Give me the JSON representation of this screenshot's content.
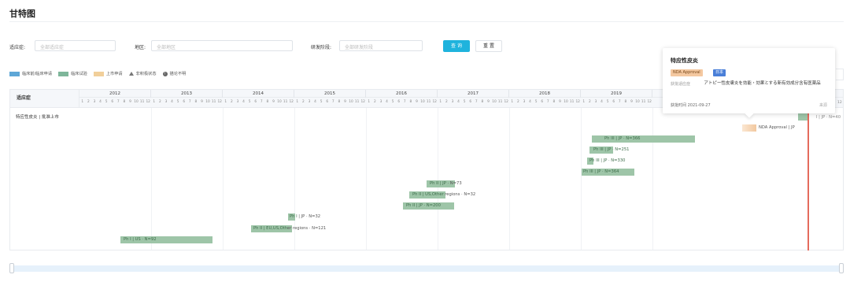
{
  "page": {
    "title": "甘特图"
  },
  "filters": {
    "indication_label": "适应症:",
    "indication_placeholder": "全部适应症",
    "region_label": "地区:",
    "region_placeholder": "全部地区",
    "phase_label": "研发阶段:",
    "phase_placeholder": "全部研发阶段",
    "query_button": "查 询",
    "reset_button": "重 置"
  },
  "legend": [
    {
      "label": "临床前/临床申请",
      "color": "#5ea7d7"
    },
    {
      "label": "临床试验",
      "color": "#7eb69a"
    },
    {
      "label": "上市申请",
      "color": "#f1cf9a"
    },
    {
      "label": "非积极状态",
      "icon": "triangle-icon"
    },
    {
      "label": "描论不明",
      "icon": "info-icon"
    }
  ],
  "table": {
    "header_label": "适应症",
    "row_label": "特应性皮炎 | 批准上市",
    "years": [
      "2012",
      "2013",
      "2014",
      "2015",
      "2016",
      "2017",
      "2018",
      "2019"
    ],
    "months": [
      "1",
      "2",
      "3",
      "4",
      "5",
      "6",
      "7",
      "8",
      "9",
      "10",
      "11",
      "12"
    ]
  },
  "bars": [
    {
      "label": "NDA Approval | JP",
      "type": "nda"
    },
    {
      "in": "Ph III | JP · N=366",
      "out": ""
    },
    {
      "in": "Ph III | JP · N=251",
      "out": ""
    },
    {
      "in": "Ph III | JP · N=330",
      "out": ""
    },
    {
      "in": "Ph III | JP · N=364",
      "out": ""
    },
    {
      "in": "Ph II | JP",
      "out": " · N=73"
    },
    {
      "in": "Ph II | US,Other",
      "out": " regions · N=32"
    },
    {
      "in": "Ph II | JP · N=200",
      "out": ""
    },
    {
      "in": "Ph I",
      "out": " | JP · N=32"
    },
    {
      "in": "Ph II | EU,US,Oth",
      "out": "er regions · N=121"
    },
    {
      "in": "Ph I | US · N=92",
      "out": ""
    }
  ],
  "partial_text": {
    "month_tail": "12",
    "bar_tail": "I | JP · N=40"
  },
  "tooltip": {
    "title": "特应性皮炎",
    "tag_stage": "NDA Approval",
    "tag_region": "日本",
    "field_label": "获批适应症",
    "field_value": "アトピー性皮膚炎を効能・効果とする新有効成分含有医薬品",
    "date": "获批时间 2021-09-27",
    "source": "来源"
  },
  "colors": {
    "accent": "#1fb3dd",
    "today_line": "#e56b5d",
    "bar": "#9ec5a8"
  }
}
